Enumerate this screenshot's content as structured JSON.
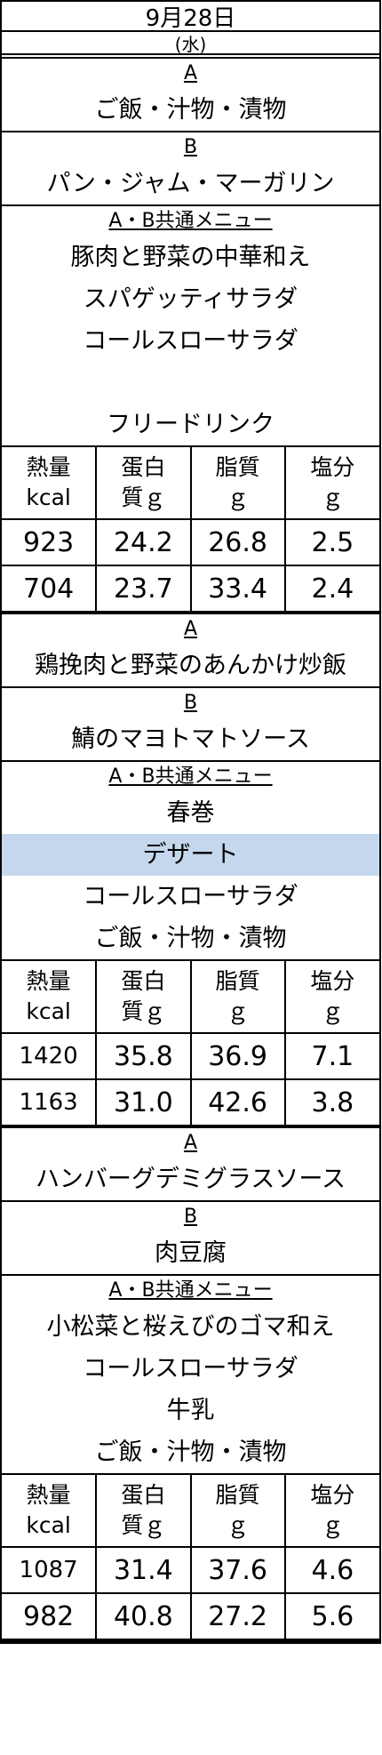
{
  "date": "9月28日",
  "weekday": "(水)",
  "nutrition_headers": [
    "熱量\nkcal",
    "蛋白\n質ｇ",
    "脂質\nｇ",
    "塩分\nｇ"
  ],
  "meals": [
    {
      "a_label": "A",
      "a_items": [
        "ご飯・汁物・漬物"
      ],
      "b_label": "B",
      "b_items": [
        "パン・ジャム・マーガリン"
      ],
      "common_label": "A・B共通メニュー",
      "common_items": [
        "豚肉と野菜の中華和え",
        "スパゲッティサラダ",
        "コールスローサラダ",
        "",
        "フリードリンク"
      ],
      "nutrition": [
        [
          "923",
          "24.2",
          "26.8",
          "2.5"
        ],
        [
          "704",
          "23.7",
          "33.4",
          "2.4"
        ]
      ]
    },
    {
      "a_label": "A",
      "a_items": [
        "鶏挽肉と野菜のあんかけ炒飯"
      ],
      "b_label": "B",
      "b_items": [
        "鯖のマヨトマトソース"
      ],
      "common_label": "A・B共通メニュー",
      "common_items": [
        "春巻",
        "デザート",
        "コールスローサラダ",
        "ご飯・汁物・漬物"
      ],
      "nutrition": [
        [
          "1420",
          "35.8",
          "36.9",
          "7.1"
        ],
        [
          "1163",
          "31.0",
          "42.6",
          "3.8"
        ]
      ]
    },
    {
      "a_label": "A",
      "a_items": [
        "ハンバーグデミグラスソース"
      ],
      "b_label": "B",
      "b_items": [
        "肉豆腐"
      ],
      "common_label": "A・B共通メニュー",
      "common_items": [
        "小松菜と桜えびのゴマ和え",
        "コールスローサラダ",
        "牛乳",
        "ご飯・汁物・漬物"
      ],
      "nutrition": [
        [
          "1087",
          "31.4",
          "37.6",
          "4.6"
        ],
        [
          "982",
          "40.8",
          "27.2",
          "5.6"
        ]
      ]
    }
  ],
  "highlight_color": "#c5d7ec"
}
